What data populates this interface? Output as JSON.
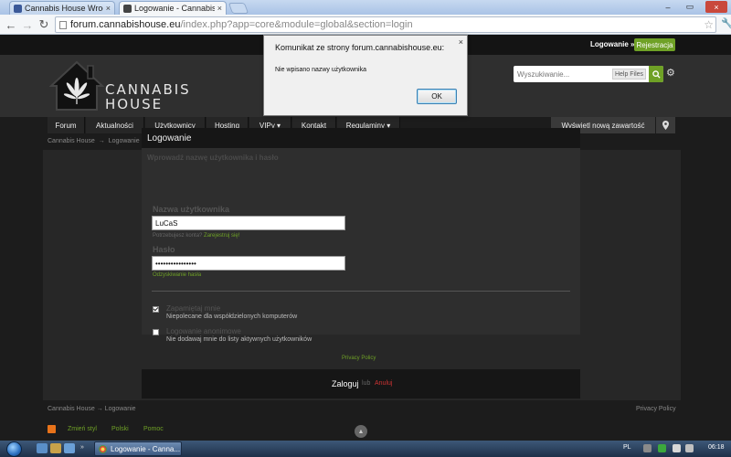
{
  "browser": {
    "tabs": [
      {
        "label": "Cannabis House Wrocław",
        "close": "×",
        "favicon_color": "#3b5998"
      },
      {
        "label": "Logowanie - Cannabis Hous",
        "close": "×",
        "favicon_color": "#444444"
      }
    ],
    "window_controls": [
      "‒",
      "▭",
      "×"
    ],
    "url_domain": "forum.cannabishouse.eu",
    "url_path": "/index.php?app=core&module=global&section=login"
  },
  "site": {
    "userbar": {
      "login": "Logowanie »",
      "register": "Rejestracja"
    },
    "logo": {
      "line1": "Cannabis",
      "line2": "House"
    },
    "search": {
      "placeholder": "Wyszukiwanie...",
      "scope": "Help Files"
    },
    "nav": {
      "items": [
        "Forum",
        "Aktualności",
        "Użytkownicy",
        "Hosting",
        "VIPy ▾",
        "Kontakt",
        "Regulaminy ▾"
      ],
      "new_content": "Wyświetl nową zawartość"
    },
    "breadcrumb": [
      "Cannabis House",
      "→",
      "Logowanie"
    ],
    "login": {
      "title": "Logowanie",
      "instruction": "Wprowadź nazwę użytkownika i hasło",
      "username_label": "Nazwa użytkownika",
      "username_value": "LuCaS",
      "need_account": "Potrzebujesz konta?",
      "register_link": "Zarejestruj się!",
      "password_label": "Hasło",
      "password_value": "••••••••••••••••",
      "forgot_link": "Odzyskiwanie hasła",
      "remember_title": "Zapamiętaj mnie",
      "remember_desc": "Niepolecane dla współdzielonych komputerów",
      "remember_checked": true,
      "anon_title": "Logowanie anonimowe",
      "anon_desc": "Nie dodawaj mnie do listy aktywnych użytkowników",
      "anon_checked": false,
      "privacy": "Privacy Policy",
      "submit": "Zaloguj",
      "or": "lub",
      "cancel": "Anuluj"
    },
    "footer": {
      "breadcrumb": [
        "Cannabis House",
        "→",
        "Logowanie"
      ],
      "privacy": "Privacy Policy",
      "links": [
        "Zmień styl",
        "Polski",
        "Pomoc"
      ]
    },
    "accent_color": "#6fa126"
  },
  "dialog": {
    "title": "Komunikat ze strony forum.cannabishouse.eu:",
    "close": "×",
    "message": "Nie wpisano nazwy użytkownika",
    "ok": "OK"
  },
  "taskbar": {
    "task_label": "Logowanie - Canna...",
    "language": "PL",
    "time": "06:18"
  }
}
